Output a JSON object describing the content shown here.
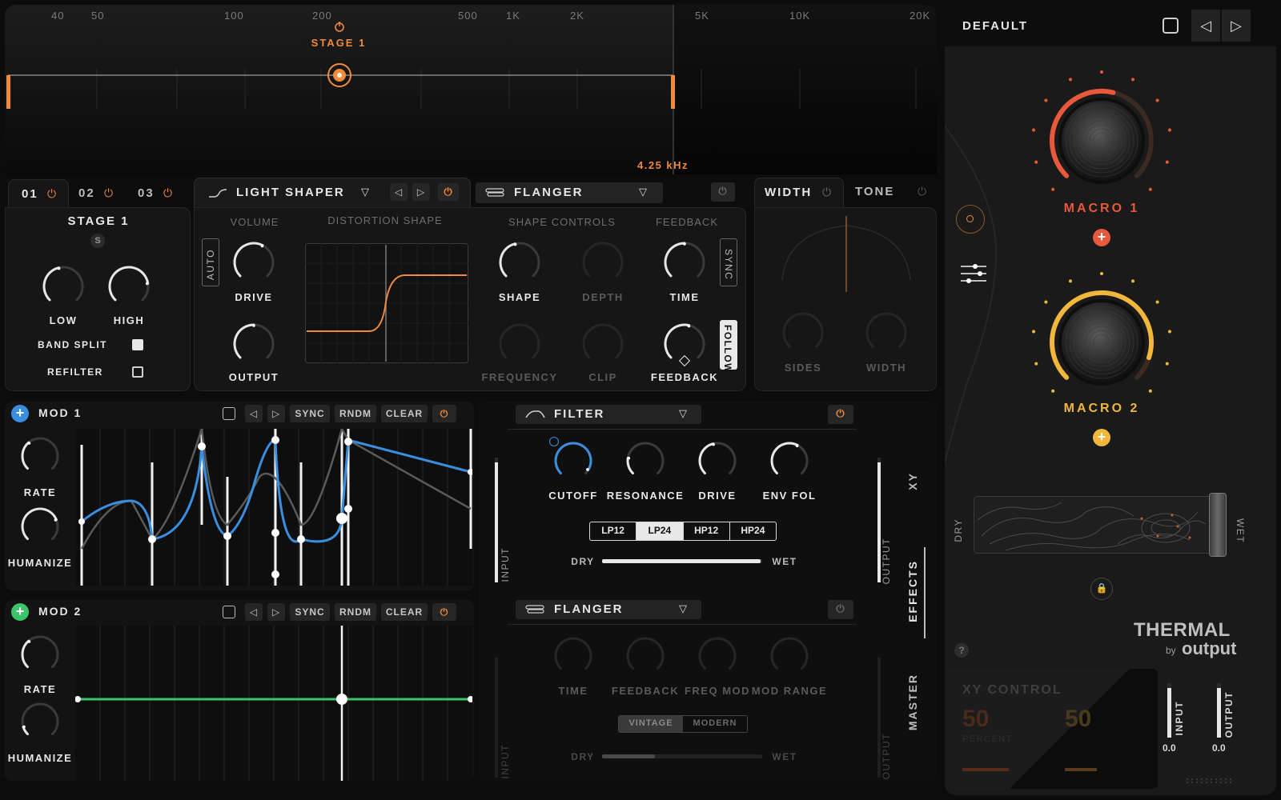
{
  "spectrum": {
    "freq_labels": [
      "40",
      "50",
      "100",
      "200",
      "500",
      "1K",
      "2K",
      "5K",
      "10K",
      "20K"
    ],
    "stage_label": "STAGE 1",
    "readout": "4.25 kHz"
  },
  "stage_tabs": [
    {
      "label": "01",
      "active": true
    },
    {
      "label": "02",
      "active": false
    },
    {
      "label": "03",
      "active": false
    }
  ],
  "stage_panel": {
    "title": "STAGE 1",
    "solo": "S",
    "knobs": [
      {
        "label": "LOW",
        "value": 0.45
      },
      {
        "label": "HIGH",
        "value": 0.8
      }
    ],
    "band_split": {
      "label": "BAND SPLIT",
      "checked": true
    },
    "refilter": {
      "label": "REFILTER",
      "checked": false
    }
  },
  "effect_slot_1": {
    "name": "LIGHT SHAPER",
    "headers": {
      "volume": "VOLUME",
      "distortion": "DISTORTION SHAPE",
      "shape_controls": "SHAPE CONTROLS",
      "feedback": "FEEDBACK"
    },
    "auto": "AUTO",
    "sync": "SYNC",
    "follow": "FOLLOW",
    "knobs": {
      "drive": "DRIVE",
      "output": "OUTPUT",
      "shape": "SHAPE",
      "depth": "DEPTH",
      "time": "TIME",
      "frequency": "FREQUENCY",
      "clip": "CLIP",
      "feedback": "FEEDBACK"
    }
  },
  "effect_slot_2": {
    "name": "FLANGER"
  },
  "width_tone": {
    "tabs": [
      "WIDTH",
      "TONE"
    ],
    "knobs": [
      "SIDES",
      "WIDTH"
    ]
  },
  "mod1": {
    "title": "MOD 1",
    "buttons": [
      "SYNC",
      "RNDM",
      "CLEAR"
    ],
    "knobs": [
      "RATE",
      "HUMANIZE"
    ]
  },
  "mod2": {
    "title": "MOD 2",
    "buttons": [
      "SYNC",
      "RNDM",
      "CLEAR"
    ],
    "knobs": [
      "RATE",
      "HUMANIZE"
    ]
  },
  "filter": {
    "name": "FILTER",
    "knobs": [
      "CUTOFF",
      "RESONANCE",
      "DRIVE",
      "ENV FOL"
    ],
    "modes": [
      "LP12",
      "LP24",
      "HP12",
      "HP24"
    ],
    "active_mode": "LP24",
    "dry": "DRY",
    "wet": "WET",
    "mix": 0.99
  },
  "flanger": {
    "name": "FLANGER",
    "knobs": [
      "TIME",
      "FEEDBACK",
      "FREQ MOD",
      "MOD RANGE"
    ],
    "modes": [
      "VINTAGE",
      "MODERN"
    ],
    "active_mode": "VINTAGE",
    "dry": "DRY",
    "wet": "WET",
    "mix": 0.33
  },
  "side_labels": {
    "input": "INPUT",
    "output": "OUTPUT",
    "xy": "XY",
    "effects": "EFFECTS",
    "master": "MASTER"
  },
  "preset": {
    "name": "DEFAULT"
  },
  "macros": [
    {
      "label": "MACRO 1",
      "color": "#e8583a",
      "value": 0.55
    },
    {
      "label": "MACRO 2",
      "color": "#f0b73a",
      "value": 0.9
    }
  ],
  "xy_pad": {
    "dry": "DRY",
    "wet": "WET"
  },
  "brand": {
    "name": "THERMAL",
    "by": "by",
    "company": "output"
  },
  "xy_control": {
    "title": "XY CONTROL",
    "x_value": "50",
    "y_value": "50",
    "unit": "PERCENT"
  },
  "meters": {
    "input_label": "INPUT",
    "output_label": "OUTPUT",
    "input_value": "0.0",
    "output_value": "0.0"
  },
  "colors": {
    "accent": "#f08a3c",
    "blue": "#3a8ee0",
    "green": "#3cc46a",
    "macro1": "#e8583a",
    "macro2": "#f0b73a"
  }
}
